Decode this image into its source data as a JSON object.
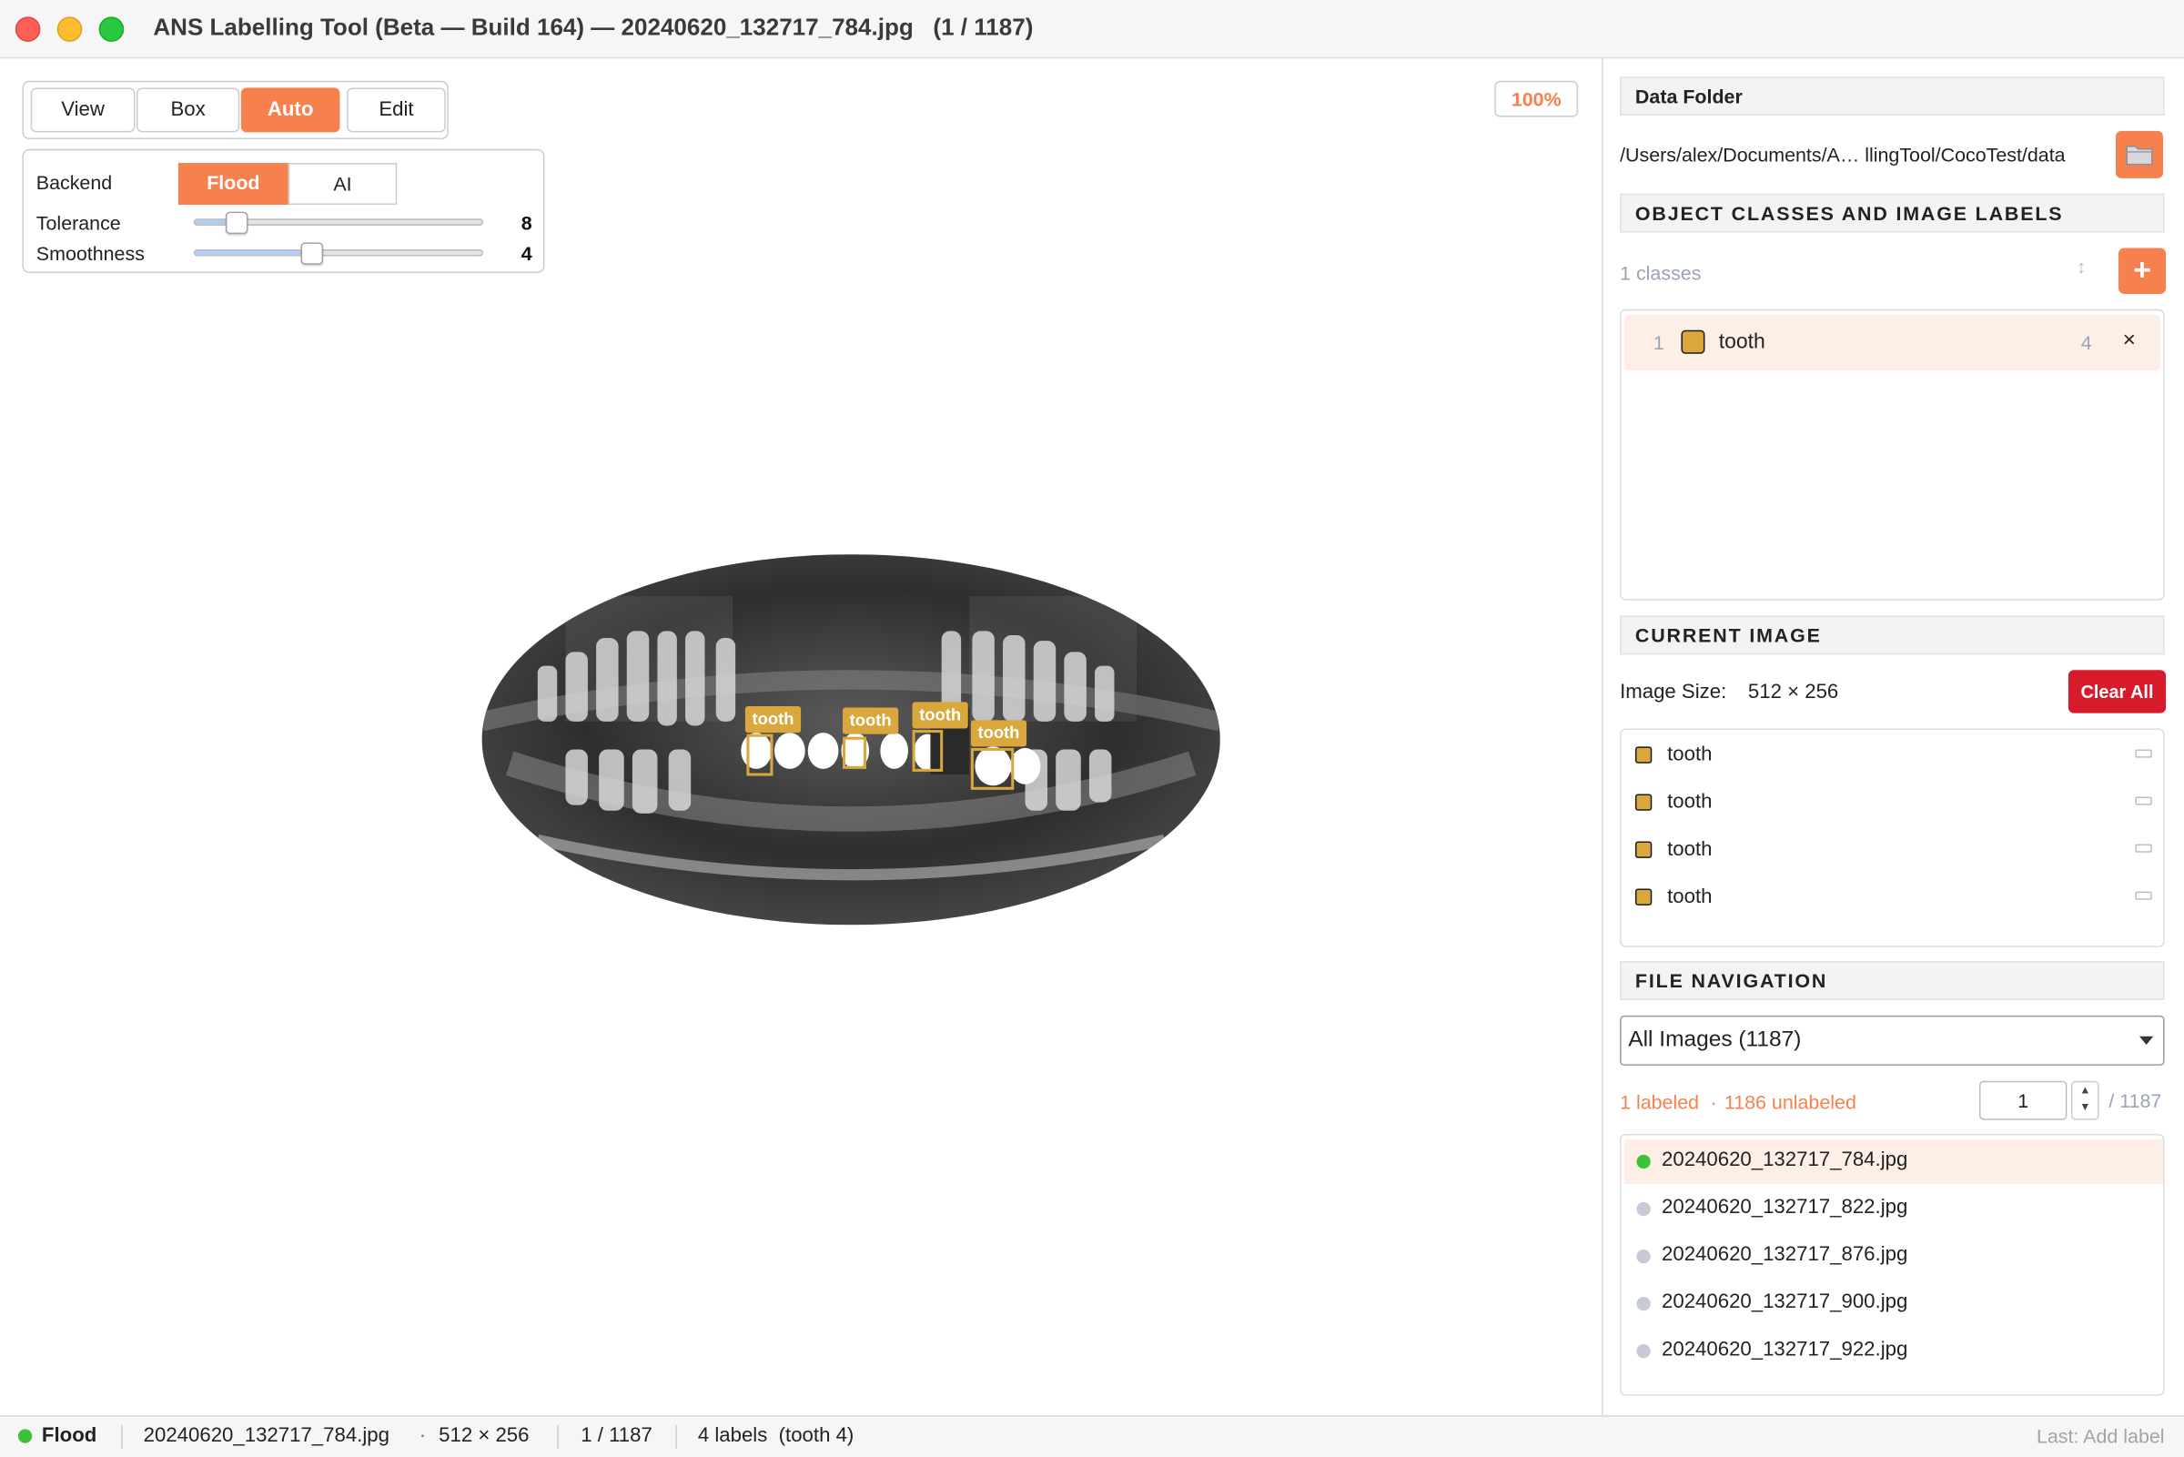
{
  "window": {
    "title": "ANS Labelling Tool (Beta — Build 164) — 20240620_132717_784.jpg   (1 / 1187)"
  },
  "toolbar": {
    "modes": [
      "View",
      "Box",
      "Auto",
      "Edit"
    ],
    "active_mode": "Auto",
    "zoom": "100%"
  },
  "auto_settings": {
    "backend_label": "Backend",
    "backend_options": [
      "Flood",
      "AI"
    ],
    "backend_selected": "Flood",
    "tolerance_label": "Tolerance",
    "tolerance_value": "8",
    "tolerance_fraction": 0.15,
    "smoothness_label": "Smoothness",
    "smoothness_value": "4",
    "smoothness_fraction": 0.41
  },
  "canvas": {
    "annotation_labels": [
      "tooth",
      "tooth",
      "tooth",
      "tooth"
    ]
  },
  "data_folder": {
    "header": "Data Folder",
    "path": "/Users/alex/Documents/A… llingTool/CocoTest/data",
    "folder_button_icon": "folder-icon"
  },
  "classes": {
    "header": "OBJECT CLASSES AND IMAGE LABELS",
    "count_text": "1 classes",
    "sort_icon": "sort-icon",
    "add_icon": "plus-icon",
    "add_label": "+",
    "items": [
      {
        "index": "1",
        "name": "tooth",
        "count": "4",
        "color": "#d9a73b",
        "remove": "×"
      }
    ]
  },
  "current_image": {
    "header": "CURRENT IMAGE",
    "size_label": "Image Size:",
    "size_value": "512 × 256",
    "clear_all": "Clear All",
    "labels": [
      "tooth",
      "tooth",
      "tooth",
      "tooth"
    ]
  },
  "file_nav": {
    "header": "FILE NAVIGATION",
    "filter": "All Images (1187)",
    "labeled": "1 labeled",
    "separator": "·",
    "unlabeled": "1186 unlabeled",
    "page": "1",
    "total": "/ 1187",
    "files": [
      {
        "name": "20240620_132717_784.jpg",
        "status": "labeled"
      },
      {
        "name": "20240620_132717_822.jpg",
        "status": "unlabeled"
      },
      {
        "name": "20240620_132717_876.jpg",
        "status": "unlabeled"
      },
      {
        "name": "20240620_132717_900.jpg",
        "status": "unlabeled"
      },
      {
        "name": "20240620_132717_922.jpg",
        "status": "unlabeled"
      }
    ],
    "labeled_color": "#3cc13b",
    "unlabeled_color": "#c6c9d6"
  },
  "status_bar": {
    "backend": "Flood",
    "file": "20240620_132717_784.jpg",
    "dot": "·",
    "size": "512 × 256",
    "position": "1 / 1187",
    "labels": "4 labels  (tooth 4)",
    "last_action": "Last: Add label"
  },
  "colors": {
    "accent": "#f6814f",
    "danger": "#d81b2b",
    "class_tooth": "#d9a73b"
  }
}
